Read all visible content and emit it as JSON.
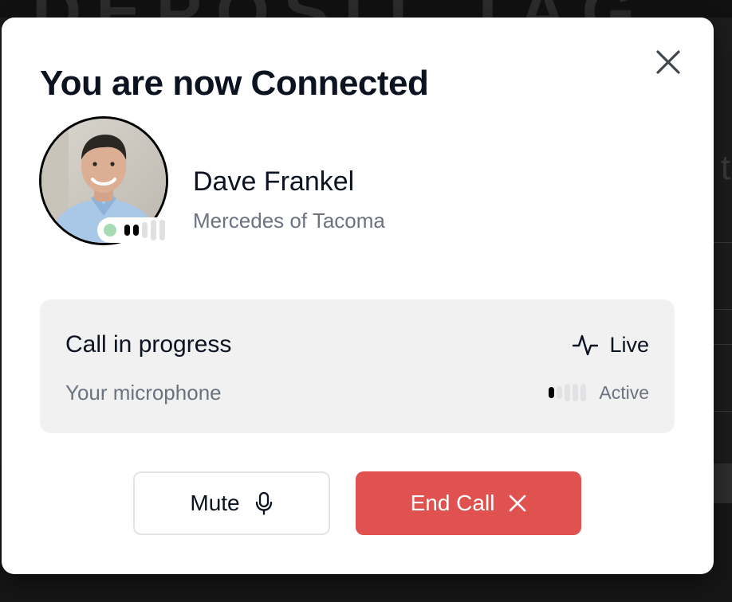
{
  "background": {
    "heading_fragment": "DEPOSIT TAG",
    "side_letter": "t"
  },
  "modal": {
    "title": "You are now Connected",
    "close_icon": "close-icon"
  },
  "contact": {
    "name": "Dave Frankel",
    "company": "Mercedes of Tacoma",
    "presence": "online",
    "presence_color": "#a6dbb6",
    "signal_level": 2,
    "signal_max": 5
  },
  "call": {
    "status": "Call in progress",
    "live_icon": "activity-icon",
    "live_label": "Live",
    "mic_label": "Your microphone",
    "mic_level": 1,
    "mic_max": 5,
    "mic_state": "Active"
  },
  "actions": {
    "mute_label": "Mute",
    "mute_icon": "microphone-icon",
    "end_label": "End Call",
    "end_icon": "close-icon",
    "end_color": "#e0524f"
  }
}
